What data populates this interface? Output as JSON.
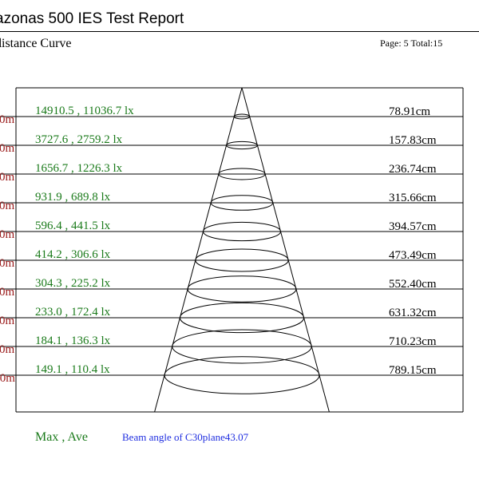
{
  "report": {
    "title": "azonas 500 IES Test Report",
    "subtitle": "distance Curve",
    "page_label": "Page: 5  Total:15"
  },
  "chart_data": {
    "type": "table",
    "rows": [
      {
        "left_label": "0m",
        "lux": "14910.5 , 11036.7 lx",
        "max": 14910.5,
        "ave": 11036.7,
        "diameter": "78.91cm"
      },
      {
        "left_label": "0m",
        "lux": "3727.6 , 2759.2 lx",
        "max": 3727.6,
        "ave": 2759.2,
        "diameter": "157.83cm"
      },
      {
        "left_label": "0m",
        "lux": "1656.7 , 1226.3 lx",
        "max": 1656.7,
        "ave": 1226.3,
        "diameter": "236.74cm"
      },
      {
        "left_label": "0m",
        "lux": "931.9 , 689.8 lx",
        "max": 931.9,
        "ave": 689.8,
        "diameter": "315.66cm"
      },
      {
        "left_label": "0m",
        "lux": "596.4 , 441.5 lx",
        "max": 596.4,
        "ave": 441.5,
        "diameter": "394.57cm"
      },
      {
        "left_label": "0m",
        "lux": "414.2 , 306.6 lx",
        "max": 414.2,
        "ave": 306.6,
        "diameter": "473.49cm"
      },
      {
        "left_label": "0m",
        "lux": "304.3 , 225.2 lx",
        "max": 304.3,
        "ave": 225.2,
        "diameter": "552.40cm"
      },
      {
        "left_label": "0m",
        "lux": "233.0 , 172.4 lx",
        "max": 233.0,
        "ave": 172.4,
        "diameter": "631.32cm"
      },
      {
        "left_label": "0m",
        "lux": "184.1 , 136.3 lx",
        "max": 184.1,
        "ave": 136.3,
        "diameter": "710.23cm"
      },
      {
        "left_label": ".0m",
        "lux": "149.1 , 110.4 lx",
        "max": 149.1,
        "ave": 110.4,
        "diameter": "789.15cm"
      }
    ],
    "legend": "Max , Ave",
    "beam_angle_label": "Beam angle of C30plane43.07",
    "colors": {
      "lux_text": "#1a7a1a",
      "left_label": "#9a1a1a",
      "beam_text": "#1f2ee0",
      "lines": "#000000"
    }
  }
}
